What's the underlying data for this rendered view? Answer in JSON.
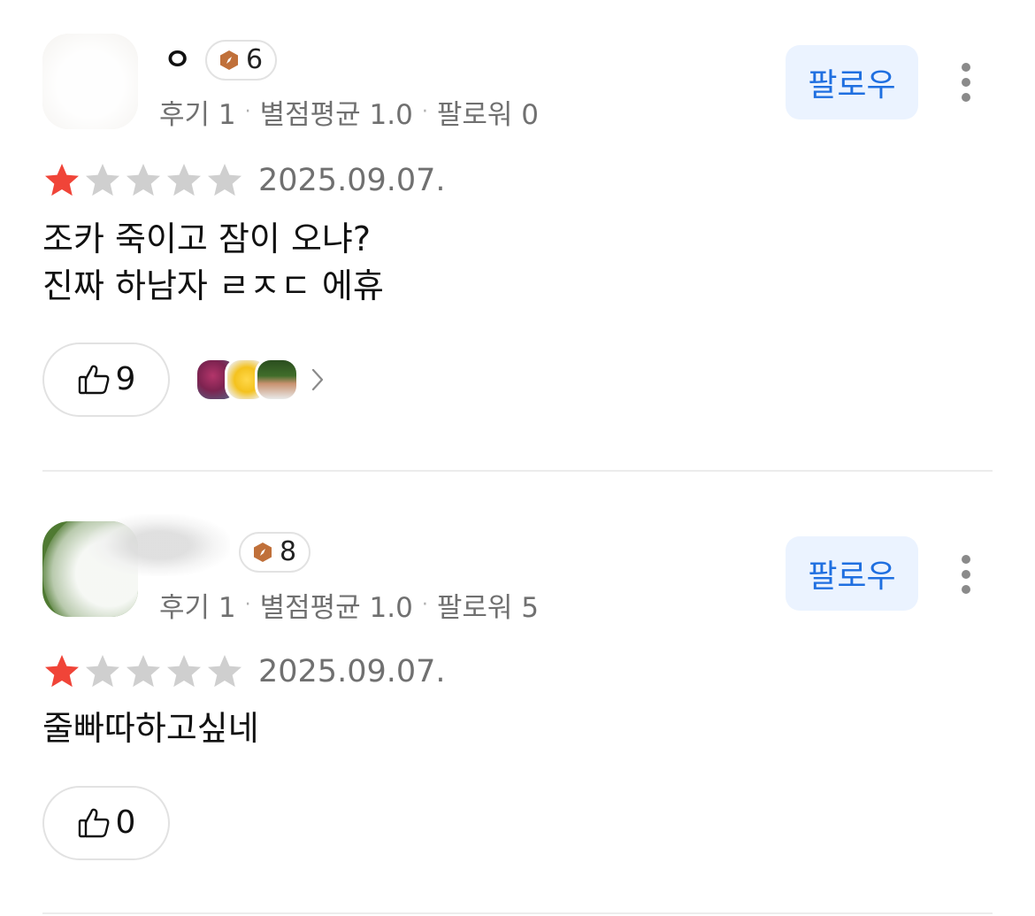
{
  "reviews": [
    {
      "nickname": "ㅇ",
      "level": "6",
      "stats": {
        "review_count": "후기 1",
        "avg_rating": "별점평균 1.0",
        "followers": "팔로워 0"
      },
      "follow_label": "팔로우",
      "rating": 1,
      "rating_max": 5,
      "date": "2025.09.07.",
      "text": "조카 죽이고 잠이 오냐?\n진짜 하남자 ㄹㅈㄷ 에휴",
      "likes": "9",
      "reactor_icons": [
        "flower-avatar",
        "emoji-avatar",
        "person-avatar"
      ]
    },
    {
      "nickname": "",
      "level": "8",
      "stats": {
        "review_count": "후기 1",
        "avg_rating": "별점평균 1.0",
        "followers": "팔로워 5"
      },
      "follow_label": "팔로우",
      "rating": 1,
      "rating_max": 5,
      "date": "2025.09.07.",
      "text": "줄빠따하고싶네",
      "likes": "0"
    }
  ],
  "colors": {
    "star_active": "#f04438",
    "star_inactive": "#cfcfcf",
    "follow_bg": "#ebf3ff",
    "follow_text": "#1f6fe0",
    "level_badge": "#c0703a",
    "secondary_text": "#707070"
  },
  "icons": {
    "level": "compass-badge-icon",
    "like": "thumbs-up-icon",
    "more": "vertical-dots-icon",
    "chevron": "chevron-right-icon",
    "star": "star-icon"
  }
}
